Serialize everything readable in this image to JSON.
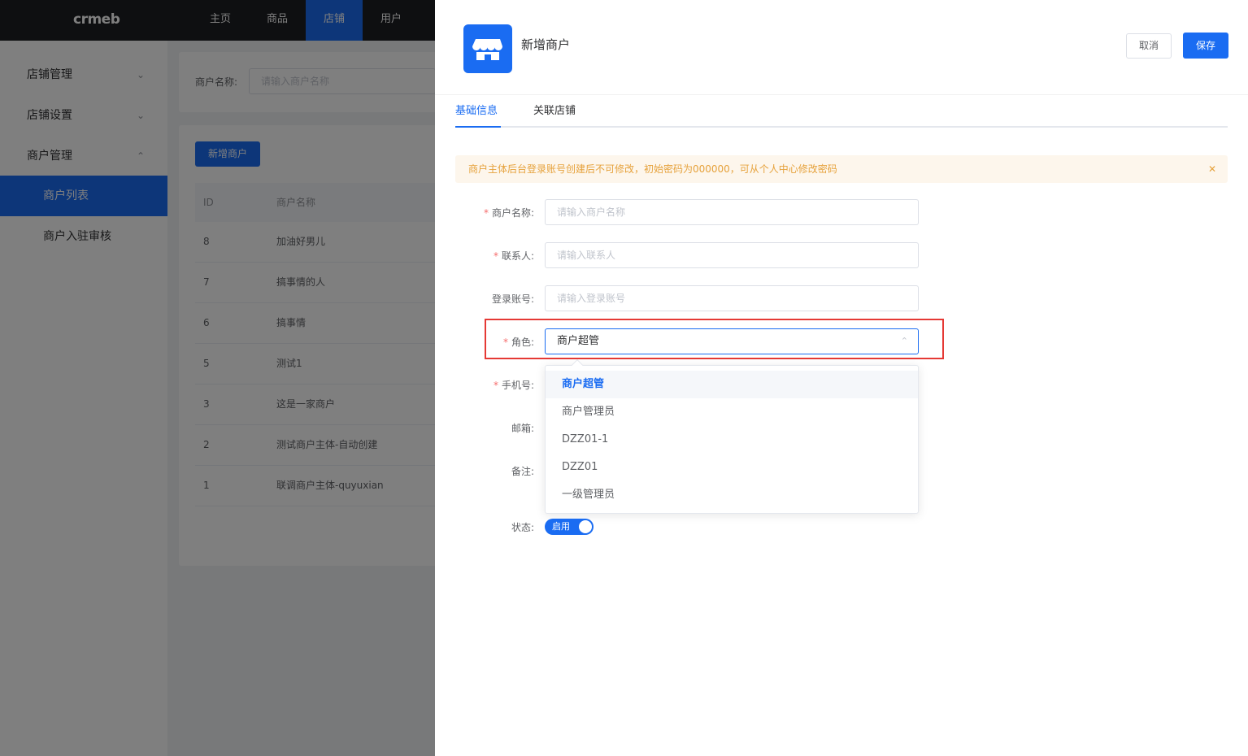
{
  "app": {
    "logo": "crmeb"
  },
  "topnav": [
    "主页",
    "商品",
    "店铺",
    "用户"
  ],
  "sidebar": {
    "groups": [
      "店铺管理",
      "店铺设置",
      "商户管理"
    ],
    "subitems": [
      "商户列表",
      "商户入驻审核"
    ]
  },
  "filter": {
    "label": "商户名称:",
    "placeholder": "请输入商户名称"
  },
  "list": {
    "add_button": "新增商户",
    "columns": [
      "ID",
      "商户名称"
    ],
    "rows": [
      {
        "id": "8",
        "name": "加油好男儿"
      },
      {
        "id": "7",
        "name": "搞事情的人"
      },
      {
        "id": "6",
        "name": "搞事情"
      },
      {
        "id": "5",
        "name": "测试1"
      },
      {
        "id": "3",
        "name": "这是一家商户"
      },
      {
        "id": "2",
        "name": "测试商户主体-自动创建"
      },
      {
        "id": "1",
        "name": "联调商户主体-quyuxian"
      }
    ]
  },
  "drawer": {
    "title": "新增商户",
    "cancel": "取消",
    "save": "保存",
    "tabs": [
      "基础信息",
      "关联店铺"
    ],
    "alert": "商户主体后台登录账号创建后不可修改，初始密码为000000，可从个人中心修改密码",
    "required_mark": "*",
    "fields": {
      "name": {
        "label": "商户名称:",
        "placeholder": "请输入商户名称"
      },
      "contact": {
        "label": "联系人:",
        "placeholder": "请输入联系人"
      },
      "account": {
        "label": "登录账号:",
        "placeholder": "请输入登录账号"
      },
      "role": {
        "label": "角色:",
        "value": "商户超管"
      },
      "phone": {
        "label": "手机号:"
      },
      "email": {
        "label": "邮箱:"
      },
      "remark": {
        "label": "备注:"
      },
      "status": {
        "label": "状态:",
        "value": "启用"
      }
    },
    "role_options": [
      "商户超管",
      "商户管理员",
      "DZZ01-1",
      "DZZ01",
      "一级管理员"
    ]
  },
  "colors": {
    "primary": "#1a6cf2",
    "topbar": "#1d1e23",
    "warning": "#e6a23c",
    "highlight": "#e53935"
  }
}
